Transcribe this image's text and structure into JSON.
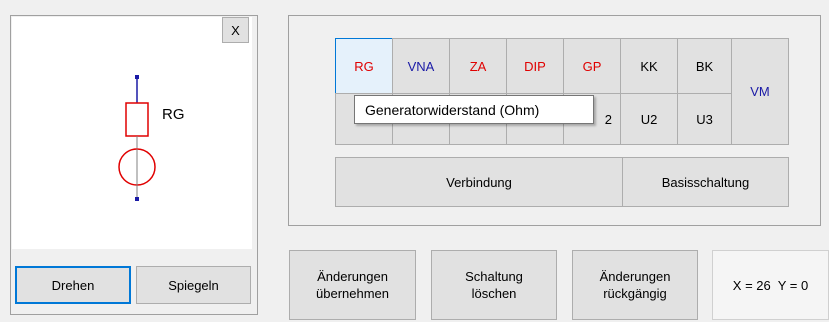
{
  "preview": {
    "component_label": "RG",
    "close_label": "X",
    "rotate_label": "Drehen",
    "mirror_label": "Spiegeln"
  },
  "palette": {
    "row1": [
      {
        "label": "RG",
        "color": "#e00000"
      },
      {
        "label": "VNA",
        "color": "#1a1aa6"
      },
      {
        "label": "ZA",
        "color": "#e00000"
      },
      {
        "label": "DIP",
        "color": "#e00000"
      },
      {
        "label": "GP",
        "color": "#e00000"
      },
      {
        "label": "KK",
        "color": "#000000"
      },
      {
        "label": "BK",
        "color": "#000000"
      }
    ],
    "vm_label": "VM",
    "vm_color": "#1a1aa6",
    "row2_visible": [
      "2",
      "U2",
      "U3"
    ],
    "connection_label": "Verbindung",
    "basic_circuit_label": "Basisschaltung"
  },
  "tooltip": {
    "text": "Generatorwiderstand (Ohm)"
  },
  "actions": {
    "apply_label": "Änderungen übernehmen",
    "clear_label": "Schaltung löschen",
    "undo_label": "Änderungen rückgängig"
  },
  "coords": {
    "text": "X = 26  Y = 0"
  },
  "colors": {
    "accent": "#0078d7",
    "symbol_red": "#e00000",
    "symbol_blue": "#1a1aa6"
  }
}
